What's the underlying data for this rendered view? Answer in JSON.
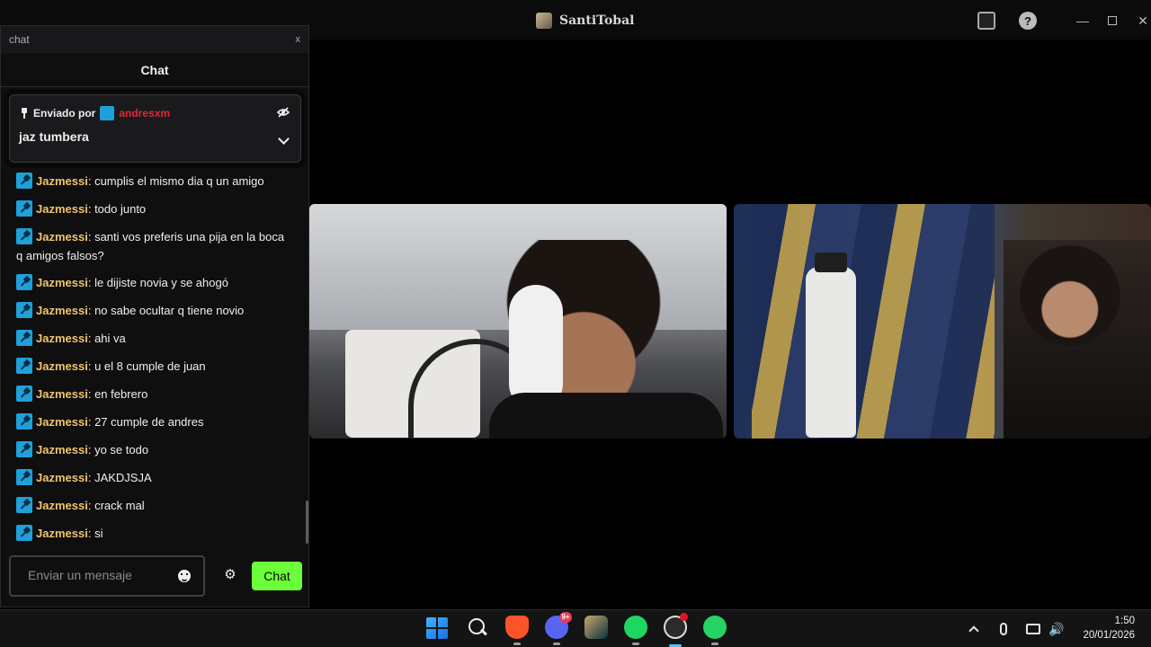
{
  "window": {
    "title": "SantiTobal",
    "controls": {
      "inbox": "inbox-icon",
      "help": "?",
      "minimize": "—",
      "maximize": "maximize-icon",
      "close": "✕"
    }
  },
  "chat": {
    "popout_title": "chat",
    "popout_close": "x",
    "header": "Chat",
    "pinned": {
      "label": "Enviado por",
      "user": "andresxm",
      "text": "jaz tumbera"
    },
    "messages": [
      {
        "user": "Jazmessi",
        "text": "cumplis el mismo dia q un amigo"
      },
      {
        "user": "Jazmessi",
        "text": "todo junto"
      },
      {
        "user": "Jazmessi",
        "text": "santi vos preferis una pija en la boca q amigos falsos?"
      },
      {
        "user": "Jazmessi",
        "text": "le dijiste novia y se ahogó"
      },
      {
        "user": "Jazmessi",
        "text": "no sabe ocultar q tiene novio"
      },
      {
        "user": "Jazmessi",
        "text": "ahi va"
      },
      {
        "user": "Jazmessi",
        "text": "u el 8 cumple de juan"
      },
      {
        "user": "Jazmessi",
        "text": "en febrero"
      },
      {
        "user": "Jazmessi",
        "text": "27 cumple de andres"
      },
      {
        "user": "Jazmessi",
        "text": "yo se todo"
      },
      {
        "user": "Jazmessi",
        "text": "JAKDJSJA"
      },
      {
        "user": "Jazmessi",
        "text": "crack mal"
      },
      {
        "user": "Jazmessi",
        "text": "si"
      }
    ],
    "input_placeholder": "Enviar un mensaje",
    "send_label": "Chat"
  },
  "taskbar": {
    "apps": [
      "windows-start",
      "search",
      "brave",
      "discord",
      "league-of-legends",
      "spotify",
      "obs",
      "whatsapp"
    ],
    "discord_badge": "9+",
    "time": "1:50",
    "date": "20/01/2026"
  },
  "colors": {
    "send_button": "#6bff3a",
    "username": "#f0c36b",
    "pinned_user": "#e0263b",
    "badge": "#1fa0d8"
  }
}
